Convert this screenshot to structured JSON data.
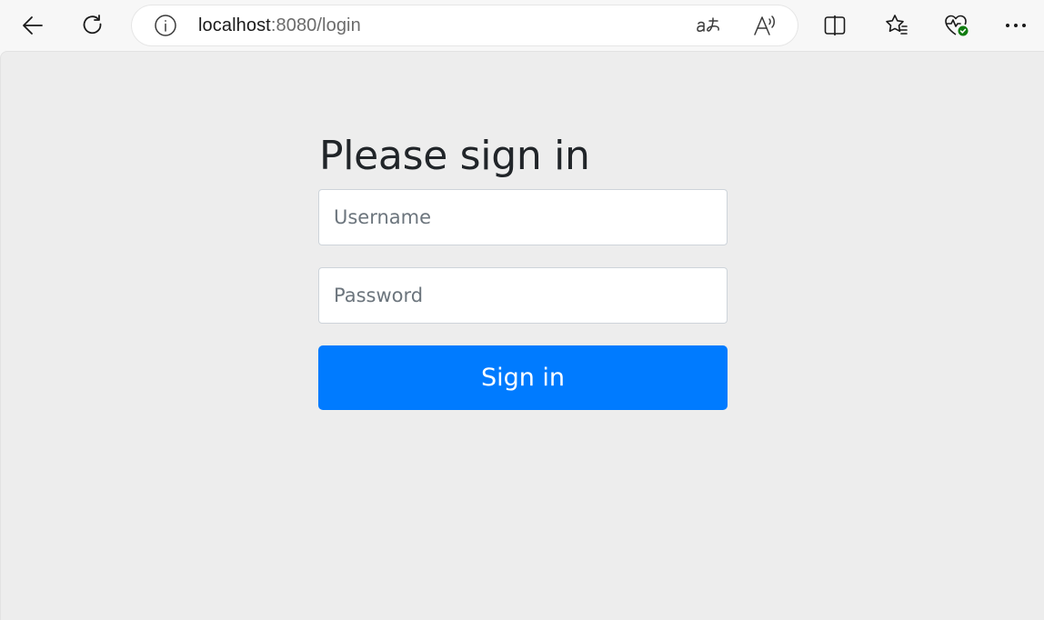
{
  "browser": {
    "url_host": "localhost",
    "url_path": ":8080/login",
    "toolbar_icons": [
      "back-icon",
      "reload-icon",
      "info-icon",
      "translate-icon",
      "read-aloud-icon",
      "split-screen-icon",
      "favorites-icon",
      "browser-essentials-icon",
      "more-icon"
    ]
  },
  "page": {
    "heading": "Please sign in",
    "username_placeholder": "Username",
    "password_placeholder": "Password",
    "submit_label": "Sign in"
  },
  "colors": {
    "primary": "#007bff",
    "page_background": "#ededed",
    "heading_text": "#212529",
    "status_ok": "#107c10"
  }
}
